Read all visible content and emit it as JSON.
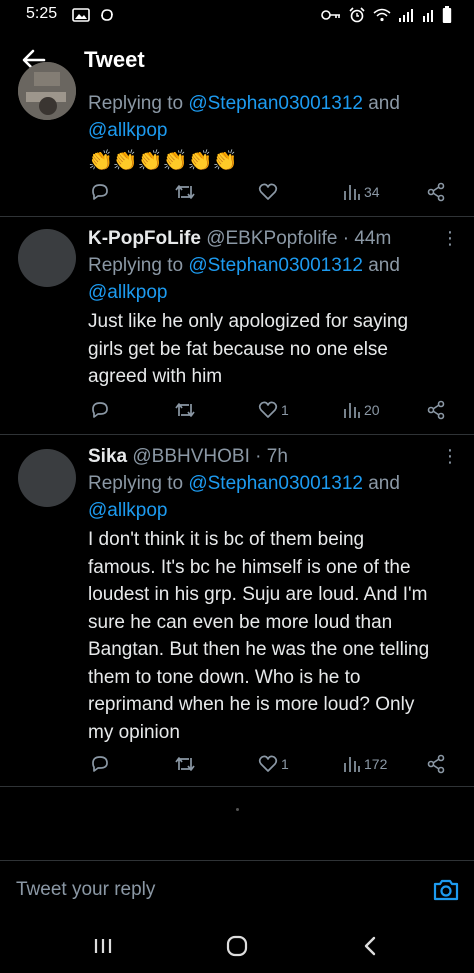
{
  "status_bar": {
    "time": "5:25"
  },
  "header": {
    "title": "Tweet"
  },
  "tweets": [
    {
      "reply_prefix": "Replying to",
      "mention1": "@Stephan03001312",
      "and": "and",
      "mention2": "@allkpop",
      "text": "👏👏👏👏👏👏",
      "views": "34"
    },
    {
      "name": "K-PopFoLife",
      "handle": "@EBKPopfolife",
      "sep": "·",
      "time": "44m",
      "reply_prefix": "Replying to",
      "mention1": "@Stephan03001312",
      "and": "and",
      "mention2": "@allkpop",
      "text_lines": [
        "Just like he only apologized for saying",
        "girls get be fat because no one else",
        "agreed with him"
      ],
      "likes": "1",
      "views": "20"
    },
    {
      "name": "Sika",
      "handle": "@BBHVHOBI",
      "sep": "·",
      "time": "7h",
      "reply_prefix": "Replying to",
      "mention1": "@Stephan03001312",
      "and": "and",
      "mention2": "@allkpop",
      "text_lines": [
        "I don't think it is bc of them being",
        "famous. It's bc he himself is one of the",
        "loudest in his grp. Suju are loud. And I'm",
        "sure he can even be more loud than",
        "Bangtan. But then he was the one telling",
        "them to tone down. Who is he to",
        "reprimand when he is more loud? Only",
        "my opinion"
      ],
      "likes": "1",
      "views": "172"
    }
  ],
  "reply_bar": {
    "placeholder": "Tweet your reply"
  },
  "colors": {
    "background": "#000000",
    "accent": "#1d9bf0",
    "muted": "#8b98a5",
    "divider": "#2f3336"
  }
}
